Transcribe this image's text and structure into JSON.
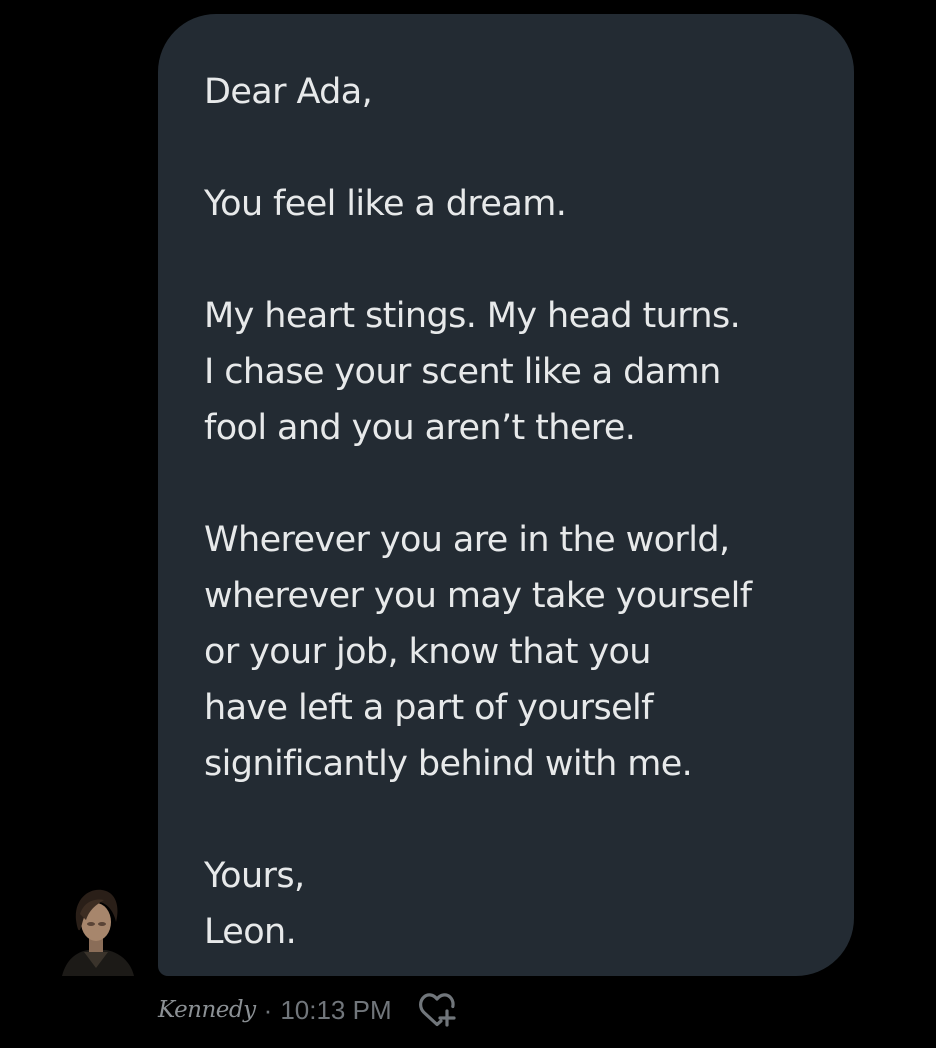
{
  "message": {
    "lines": [
      "Dear Ada,",
      "",
      "You feel like a dream.",
      "",
      "My heart stings. My head turns.",
      "I chase your scent like a damn",
      "fool and you aren’t there.",
      "",
      "Wherever you are in the world,",
      "wherever you may take yourself",
      "or your job, know that you",
      "have left a part of yourself",
      "significantly behind with me.",
      "",
      "Yours,",
      "Leon."
    ]
  },
  "meta": {
    "sender": "Kennedy",
    "separator": "·",
    "time": "10:13 PM",
    "reaction_icon": "add-reaction-heart-icon"
  },
  "colors": {
    "background": "#000000",
    "bubble": "#232b33",
    "text": "#e7e9ea",
    "meta": "#71767b"
  }
}
